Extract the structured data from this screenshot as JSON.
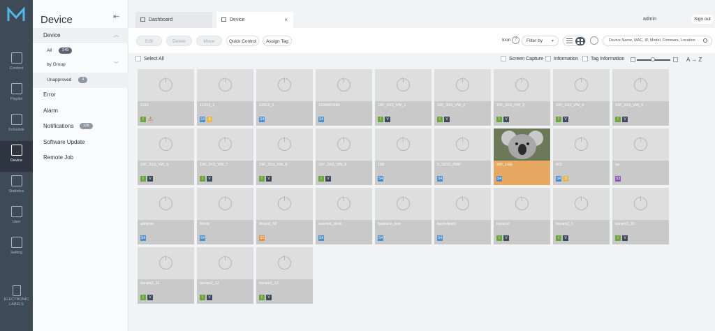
{
  "colors": {
    "tag_i": "#6ea53c",
    "tag_v": "#3c4a5b",
    "tag_s4": "#4a90d0",
    "tag_s2": "#e5913a",
    "tag_s3": "#8b58b8",
    "tag_warn": "#e04a3a",
    "tag_s": "#e9b84c"
  },
  "rail": {
    "items": [
      {
        "label": "Content",
        "icon": "content-icon"
      },
      {
        "label": "Playlist",
        "icon": "playlist-icon"
      },
      {
        "label": "Schedule",
        "icon": "schedule-icon"
      },
      {
        "label": "Device",
        "icon": "device-icon"
      },
      {
        "label": "Statistics",
        "icon": "statistics-icon"
      },
      {
        "label": "User",
        "icon": "user-icon"
      },
      {
        "label": "Setting",
        "icon": "setting-icon"
      },
      {
        "label": "ELECTRONIC LABELS",
        "icon": "electronic-labels-icon"
      }
    ]
  },
  "side": {
    "title": "Device",
    "back": "⇤",
    "device_label": "Device",
    "all_label": "All",
    "all_count": "249",
    "by_group": "by Group",
    "unapproved": "Unapproved",
    "unapproved_count": "4",
    "error": "Error",
    "alarm": "Alarm",
    "notifications": "Notifications",
    "notifications_count": "128",
    "software_update": "Software Update",
    "remote_job": "Remote Job"
  },
  "tabs": {
    "dashboard": "Dashboard",
    "device": "Device",
    "close": "×"
  },
  "header": {
    "user": "admin",
    "signout": "Sign out"
  },
  "toolbar": {
    "edit": "Edit",
    "delete": "Delete",
    "move": "Move",
    "quick_control": "Quick Control",
    "assign_tag": "Assign Tag",
    "icon_label": "Icon",
    "help": "?",
    "filter": "Filter by",
    "search_placeholder": "Device Name, MAC, IP, Model, Firmware, Location"
  },
  "options": {
    "select_all": "Select All",
    "screen_capture": "Screen Capture",
    "information": "Information",
    "tag_information": "Tag Information",
    "sort": "A → Z"
  },
  "devices": [
    {
      "name": "1221",
      "tags": [
        {
          "t": "I",
          "c": "#6ea53c"
        },
        {
          "t": "⚠",
          "c": "#e04a3a"
        }
      ]
    },
    {
      "name": "12312_1",
      "tags": [
        {
          "t": "S4",
          "c": "#4a90d0"
        },
        {
          "t": "S",
          "c": "#e9b84c"
        }
      ]
    },
    {
      "name": "12312_2",
      "tags": [
        {
          "t": "S4",
          "c": "#4a90d0"
        }
      ]
    },
    {
      "name": "1234567689",
      "tags": [
        {
          "t": "S4",
          "c": "#4a90d0"
        }
      ]
    },
    {
      "name": "15F_3X3_VW_1",
      "tags": [
        {
          "t": "I",
          "c": "#6ea53c"
        },
        {
          "t": "V",
          "c": "#3c4a5b"
        }
      ]
    },
    {
      "name": "15F_3X3_VW_2",
      "tags": [
        {
          "t": "I",
          "c": "#6ea53c"
        },
        {
          "t": "V",
          "c": "#3c4a5b"
        }
      ]
    },
    {
      "name": "15F_3X3_VW_3",
      "tags": [
        {
          "t": "I",
          "c": "#6ea53c"
        },
        {
          "t": "V",
          "c": "#3c4a5b"
        }
      ]
    },
    {
      "name": "15F_3X3_VW_4",
      "tags": [
        {
          "t": "I",
          "c": "#6ea53c"
        },
        {
          "t": "V",
          "c": "#3c4a5b"
        }
      ]
    },
    {
      "name": "15F_3X3_VW_5",
      "tags": [
        {
          "t": "I",
          "c": "#6ea53c"
        },
        {
          "t": "V",
          "c": "#3c4a5b"
        }
      ]
    },
    {
      "name": "15F_3X3_VW_6",
      "tags": [
        {
          "t": "I",
          "c": "#6ea53c"
        },
        {
          "t": "V",
          "c": "#3c4a5b"
        }
      ]
    },
    {
      "name": "15F_3X3_VW_7",
      "tags": [
        {
          "t": "I",
          "c": "#6ea53c"
        },
        {
          "t": "V",
          "c": "#3c4a5b"
        }
      ]
    },
    {
      "name": "15F_3X3_VW_8",
      "tags": [
        {
          "t": "I",
          "c": "#6ea53c"
        },
        {
          "t": "V",
          "c": "#3c4a5b"
        }
      ]
    },
    {
      "name": "15F_3X3_VW_9",
      "tags": [
        {
          "t": "I",
          "c": "#6ea53c"
        },
        {
          "t": "V",
          "c": "#3c4a5b"
        }
      ]
    },
    {
      "name": "198",
      "tags": [
        {
          "t": "S4",
          "c": "#4a90d0"
        }
      ]
    },
    {
      "name": "2_S2S3_PMF",
      "tags": [
        {
          "t": "S4",
          "c": "#4a90d0"
        }
      ]
    },
    {
      "name": "20F_LEE",
      "tags": [
        {
          "t": "S4",
          "c": "#4a90d0"
        }
      ],
      "photo": true
    },
    {
      "name": "602",
      "tags": [
        {
          "t": "S4",
          "c": "#4a90d0"
        },
        {
          "t": "S",
          "c": "#e9b84c"
        }
      ]
    },
    {
      "name": "aa",
      "tags": [
        {
          "t": "S3",
          "c": "#8b58b8"
        }
      ]
    },
    {
      "name": "abhinav",
      "tags": [
        {
          "t": "S4",
          "c": "#4a90d0"
        }
      ]
    },
    {
      "name": "Akula",
      "tags": [
        {
          "t": "S4",
          "c": "#4a90d0"
        }
      ]
    },
    {
      "name": "Anand_S2",
      "tags": [
        {
          "t": "S2",
          "c": "#e5913a"
        }
      ]
    },
    {
      "name": "avishek_desk",
      "tags": [
        {
          "t": "S4",
          "c": "#4a90d0"
        }
      ]
    },
    {
      "name": "bakkane_test",
      "tags": [
        {
          "t": "S4",
          "c": "#4a90d0"
        }
      ]
    },
    {
      "name": "bayle4park",
      "tags": [
        {
          "t": "S4",
          "c": "#4a90d0"
        }
      ]
    },
    {
      "name": "boram2",
      "tags": [
        {
          "t": "I",
          "c": "#6ea53c"
        },
        {
          "t": "V",
          "c": "#3c4a5b"
        }
      ]
    },
    {
      "name": "boram2_1",
      "tags": [
        {
          "t": "I",
          "c": "#6ea53c"
        },
        {
          "t": "V",
          "c": "#3c4a5b"
        }
      ]
    },
    {
      "name": "boram2_10",
      "tags": [
        {
          "t": "I",
          "c": "#6ea53c"
        },
        {
          "t": "V",
          "c": "#3c4a5b"
        }
      ]
    },
    {
      "name": "boram2_11",
      "tags": [
        {
          "t": "I",
          "c": "#6ea53c"
        },
        {
          "t": "V",
          "c": "#3c4a5b"
        }
      ]
    },
    {
      "name": "boram2_12",
      "tags": [
        {
          "t": "I",
          "c": "#6ea53c"
        },
        {
          "t": "V",
          "c": "#3c4a5b"
        }
      ]
    },
    {
      "name": "boram2_13",
      "tags": [
        {
          "t": "I",
          "c": "#6ea53c"
        },
        {
          "t": "V",
          "c": "#3c4a5b"
        }
      ]
    }
  ]
}
